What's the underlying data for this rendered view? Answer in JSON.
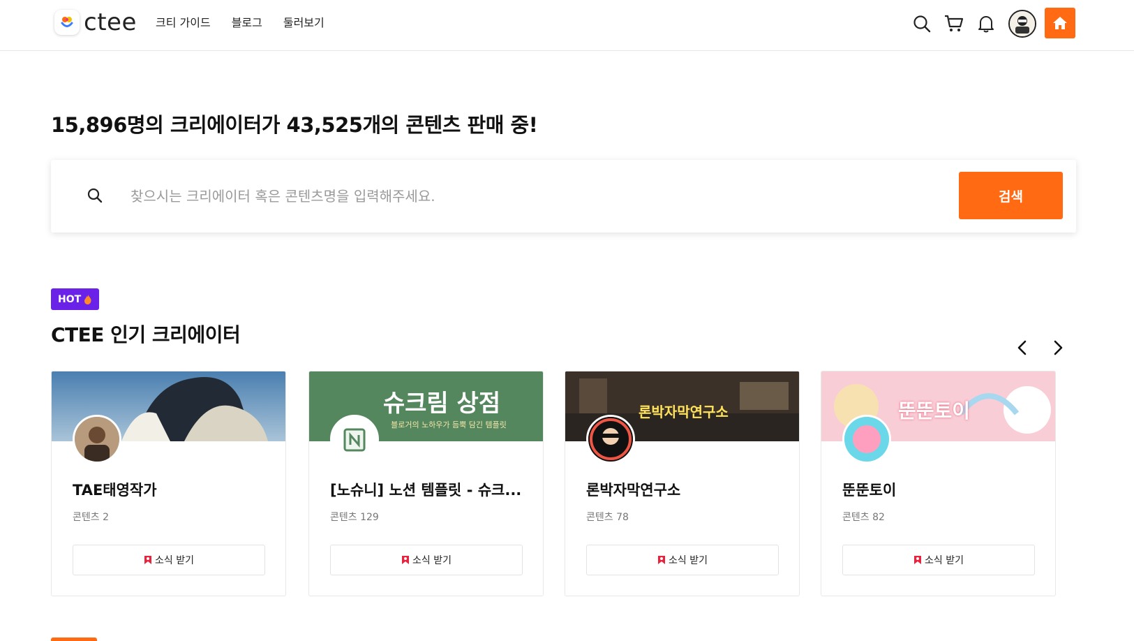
{
  "brand": {
    "name": "ctee",
    "accent": "#ff6a13",
    "badge_color": "#6a22e8"
  },
  "nav": {
    "items": [
      "크티 가이드",
      "블로그",
      "둘러보기"
    ]
  },
  "header_icons": [
    "search-icon",
    "cart-icon",
    "bell-icon",
    "user-avatar",
    "home-icon"
  ],
  "hero": {
    "title": "15,896명의 크리에이터가 43,525개의 콘텐츠 판매 중!"
  },
  "search": {
    "placeholder": "찾으시는 크리에이터 혹은 콘텐츠명을 입력해주세요.",
    "button_label": "검색"
  },
  "hot": {
    "badge": "HOT",
    "title": "CTEE 인기 크리에이터",
    "cards": [
      {
        "name": "TAE태영작가",
        "count_label": "콘텐츠 2",
        "subscribe_label": "소식 받기"
      },
      {
        "name": "[노슈니] 노션 템플릿 - 슈크...",
        "count_label": "콘텐츠 129",
        "subscribe_label": "소식 받기",
        "banner_text": "슈크림 상점",
        "banner_sub": "블로거의 노하우가 듬뿍 담긴 템플릿"
      },
      {
        "name": "론박자막연구소",
        "count_label": "콘텐츠 78",
        "subscribe_label": "소식 받기",
        "banner_text": "론박자막연구소"
      },
      {
        "name": "뚠뚠토이",
        "count_label": "콘텐츠 82",
        "subscribe_label": "소식 받기",
        "banner_text": "뚠뚠토이"
      }
    ]
  }
}
